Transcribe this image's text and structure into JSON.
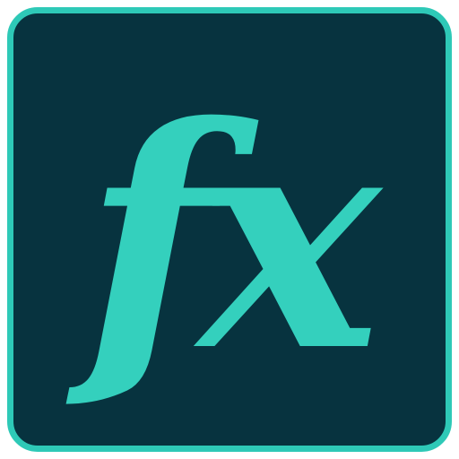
{
  "icon": {
    "label": "fx",
    "semantic": "function-icon",
    "colors": {
      "background": "#07333f",
      "border": "#2ec9b7",
      "glyph": "#34d0bd",
      "page": "#ffffff"
    }
  }
}
